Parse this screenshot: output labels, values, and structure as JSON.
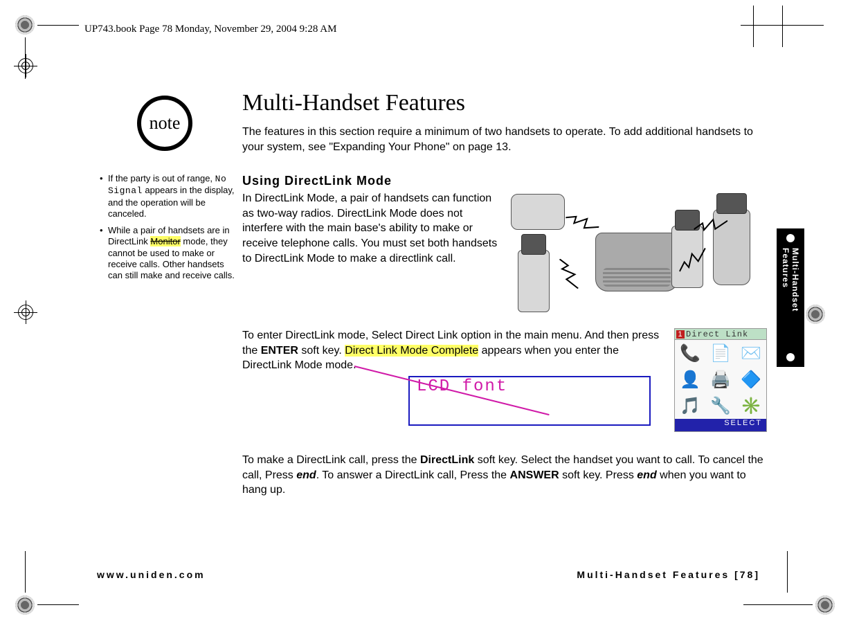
{
  "header_line": "UP743.book  Page 78  Monday, November 29, 2004  9:28 AM",
  "side_tab": "Multi-Handset Features",
  "note_badge": "note",
  "notes": {
    "item1_a": "If the party is out of range, ",
    "item1_display": "No Signal",
    "item1_b": " appears in the display, and the operation will be canceled.",
    "item2_a": "While a pair of handsets are in DirectLink ",
    "item2_monitor": "Monitor",
    "item2_b": " mode, they cannot be used to make or receive calls. Other handsets can still make and receive calls."
  },
  "title": "Multi-Handset Features",
  "intro": "The features in this section require a minimum of two handsets to operate. To add additional handsets to your system, see \"Expanding Your Phone\" on page 13.",
  "section_heading": "Using DirectLink Mode",
  "directlink_p1": "In DirectLink Mode, a pair of handsets can function as two-way radios. DirectLink Mode does not interfere with the main base's ability to make or receive telephone calls. You must set both handsets to DirectLink Mode to make a directlink call.",
  "p2": {
    "a": "To enter DirectLink mode, Select Direct Link option in the main menu. And then press the ",
    "enter": "ENTER",
    "b": " soft key. ",
    "highlight": "Direct Link Mode Complete",
    "c": " appears when you enter the DirectLink Mode mode."
  },
  "annotation_label": "LCD font",
  "lcd": {
    "number": "1",
    "title": "Direct Link",
    "footer": "SELECT",
    "icons": [
      "📞",
      "📄",
      "✉️",
      "👤",
      "🖨️",
      "🔷",
      "🎵",
      "🔧",
      "✳️"
    ]
  },
  "p3": {
    "a": "To make a DirectLink call, press the ",
    "directlink": "DirectLink",
    "b": " soft key. Select the handset you want to call. To cancel the call, Press ",
    "end1": "end",
    "c": ". To answer a DirectLink call, Press the ",
    "answer": "ANSWER",
    "d": " soft key. Press ",
    "end2": "end",
    "e": " when you want to hang up."
  },
  "footer_left": "www.uniden.com",
  "footer_right": "Multi-Handset Features [78]"
}
